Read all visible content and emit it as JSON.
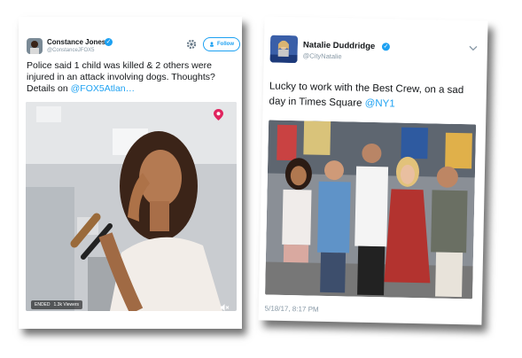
{
  "tweet_left": {
    "author_name": "Constance Jones",
    "author_handle": "@ConstanceJFOX5",
    "follow_label": "Follow",
    "text": "Police said 1 child was killed & 2 others were injured in an attack involving dogs. Thoughts? Details on",
    "mention": "@FOX5Atlan…",
    "video_status": "ENDED",
    "viewers": "1.3k Viewers"
  },
  "tweet_right": {
    "author_name": "Natalie Duddridge",
    "author_handle": "@CityNatalie",
    "text": "Lucky to work with the Best Crew, on a sad day in Times Square",
    "mention": "@NY1",
    "timestamp": "5/18/17, 8:17 PM"
  },
  "colors": {
    "accent": "#1da1f2",
    "text": "#14171a",
    "muted": "#8899a6"
  },
  "icons": [
    "gear-icon",
    "follow-person-icon",
    "verified-icon",
    "periscope-icon",
    "mute-icon",
    "chevron-down-icon"
  ]
}
